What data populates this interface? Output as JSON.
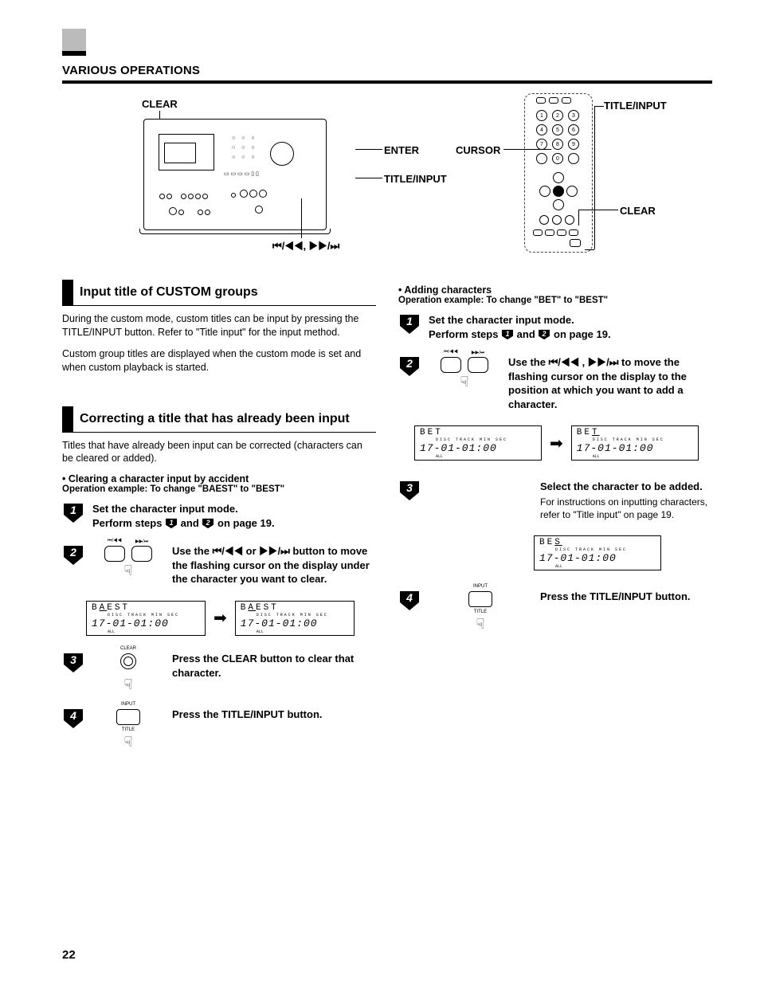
{
  "header": {
    "section": "VARIOUS OPERATIONS"
  },
  "diagram": {
    "clear_label": "CLEAR",
    "enter_label": "ENTER",
    "titleinput_label": "TITLE/INPUT",
    "seek_label": "⏮/◀◀, ▶▶/⏭",
    "cursor_label": "CURSOR",
    "remote_titleinput": "TITLE/INPUT",
    "remote_clear": "CLEAR"
  },
  "left": {
    "h1": "Input title of CUSTOM groups",
    "p1": "During the custom mode, custom titles can be input by pressing the TITLE/INPUT button. Refer to \"Title input\" for the input method.",
    "p2": "Custom group titles are displayed when the custom mode is set and when custom playback is started.",
    "h2": "Correcting a title that has already been input",
    "p3": "Titles that have already been input can be corrected (characters can be cleared or added).",
    "bullet1": "•  Clearing a character input by accident",
    "opex1": "Operation example: To change \"BAEST\" to \"BEST\"",
    "s1": "Set the character input mode.",
    "s1b": "Perform steps 1 and 2 on page 19.",
    "s2": "Use the ⏮/◀◀ or ▶▶/⏭ button to move the flashing cursor on the display under the character you want to clear.",
    "lcd1": "BAEST",
    "lcdlabels": "DISC      TRACK      MIN      SEC",
    "lcdtime": "17-01-01:00",
    "lcdall": "ALL",
    "s3": "Press the CLEAR button to clear that character.",
    "s4": "Press the TITLE/INPUT button.",
    "btn_skip_prev": "⏮/◀◀",
    "btn_skip_next": "▶▶/⏭",
    "btn_clear": "CLEAR",
    "btn_input": "INPUT",
    "btn_title": "TITLE"
  },
  "right": {
    "bullet1": "•  Adding characters",
    "opex1": "Operation example: To change \"BET\" to \"BEST\"",
    "s1": "Set the character input mode.",
    "s1b": "Perform steps 1 and 2 on page 19.",
    "s2": "Use the ⏮/◀◀ , ▶▶/⏭ to move the flashing cursor on the display to the position at which you want to add a character.",
    "lcd1": "BET",
    "lcd2": "BET",
    "lcdlabels": "DISC      TRACK      MIN      SEC",
    "lcdtime": "17-01-01:00",
    "lcdall": "ALL",
    "s3t": "Select the character to be added.",
    "s3d": "For instructions on inputting characters, refer to \"Title input\" on page 19.",
    "lcd3": "BES",
    "s4": "Press the TITLE/INPUT button.",
    "btn_input": "INPUT",
    "btn_title": "TITLE"
  },
  "page_number": "22"
}
